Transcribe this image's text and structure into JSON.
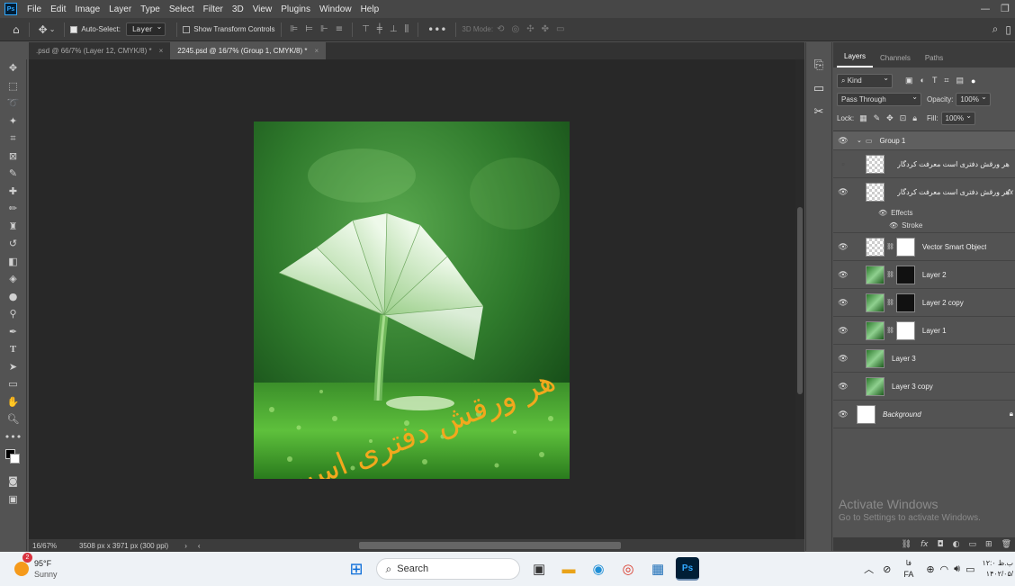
{
  "app": {
    "logo": "Ps",
    "menu": [
      "File",
      "Edit",
      "Image",
      "Layer",
      "Type",
      "Select",
      "Filter",
      "3D",
      "View",
      "Plugins",
      "Window",
      "Help"
    ]
  },
  "options": {
    "auto_select_label": "Auto-Select:",
    "auto_select_target": "Layer",
    "show_transform_label": "Show Transform Controls",
    "three_d_mode": "3D Mode:"
  },
  "tabs": [
    {
      "label": ".psd @ 66/7% (Layer 12, CMYK/8) *"
    },
    {
      "label": "2245.psd @ 16/7% (Group 1, CMYK/8) *"
    }
  ],
  "status": {
    "zoom": "16/67%",
    "doc_size": "3508 px x 3971 px (300 ppi)"
  },
  "panel": {
    "tabs": [
      "Layers",
      "Channels",
      "Paths"
    ],
    "filter_kind": "Kind",
    "blend_mode": "Pass Through",
    "opacity_label": "Opacity:",
    "opacity": "100%",
    "lock_label": "Lock:",
    "fill_label": "Fill:",
    "fill": "100%",
    "layers": [
      {
        "name": "Group 1"
      },
      {
        "name": "هر ورقش دفتری است معرفت کردگار"
      },
      {
        "name": "هر ورقش دفتری است معرفت کردگار"
      },
      {
        "name": "Effects"
      },
      {
        "name": "Stroke"
      },
      {
        "name": "Vector Smart Object"
      },
      {
        "name": "Layer 2"
      },
      {
        "name": "Layer 2 copy"
      },
      {
        "name": "Layer 1"
      },
      {
        "name": "Layer 3"
      },
      {
        "name": "Layer 3 copy"
      },
      {
        "name": "Background"
      }
    ]
  },
  "artwork": {
    "calligraphy_text": "هر ورقش دفتری است معرفت کردگار",
    "calligraphy_color": "#f2a81d"
  },
  "activate": {
    "title": "Activate Windows",
    "subtitle": "Go to Settings to activate Windows."
  },
  "taskbar": {
    "weather_temp": "95°F",
    "weather_desc": "Sunny",
    "weather_badge": "2",
    "search": "Search",
    "lang": "FA",
    "lang_top": "فا",
    "time": "۱۲:۰ ب.ظ",
    "date": "۱۴۰۲/۰۵/"
  }
}
